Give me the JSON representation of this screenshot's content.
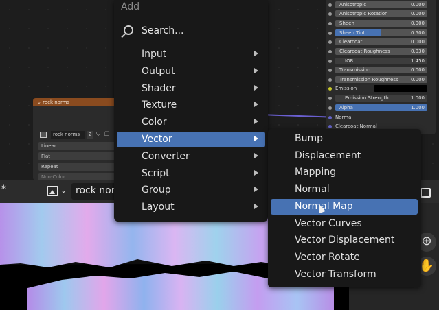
{
  "node_editor": {
    "principled_inputs": [
      {
        "label": "Anisotropic",
        "value": "0.000",
        "kind": "field"
      },
      {
        "label": "Anisotropic Rotation",
        "value": "0.000",
        "kind": "field"
      },
      {
        "label": "Sheen",
        "value": "0.000",
        "kind": "field"
      },
      {
        "label": "Sheen Tint",
        "value": "0.500",
        "kind": "blue-fill"
      },
      {
        "label": "Clearcoat",
        "value": "0.000",
        "kind": "field"
      },
      {
        "label": "Clearcoat Roughness",
        "value": "0.030",
        "kind": "field"
      },
      {
        "label": "IOR",
        "value": "1.450",
        "kind": "dark"
      },
      {
        "label": "Transmission",
        "value": "0.000",
        "kind": "field"
      },
      {
        "label": "Transmission Roughness",
        "value": "0.000",
        "kind": "field"
      },
      {
        "label": "Emission",
        "value": "",
        "kind": "swatch"
      },
      {
        "label": "Emission Strength",
        "value": "1.000",
        "kind": "dark"
      },
      {
        "label": "Alpha",
        "value": "1.000",
        "kind": "full-blue"
      },
      {
        "label": "Normal",
        "value": "",
        "kind": "plain"
      },
      {
        "label": "Clearcoat Normal",
        "value": "",
        "kind": "plain"
      }
    ],
    "texture_node": {
      "title": "rock norms",
      "image_name": "rock norms",
      "user_count": "2",
      "interpolation": "Linear",
      "projection": "Flat",
      "extension": "Repeat",
      "color_space": "Non-Color"
    }
  },
  "image_editor": {
    "image_name": "rock norm",
    "modified_marker": "*"
  },
  "add_menu": {
    "title": "Add",
    "search_label": "Search...",
    "items": [
      "Input",
      "Output",
      "Shader",
      "Texture",
      "Color",
      "Vector",
      "Converter",
      "Script",
      "Group",
      "Layout"
    ],
    "active_item": "Vector"
  },
  "vector_submenu": {
    "items": [
      "Bump",
      "Displacement",
      "Mapping",
      "Normal",
      "Normal Map",
      "Vector Curves",
      "Vector Displacement",
      "Vector Rotate",
      "Vector Transform"
    ],
    "active_item": "Normal Map"
  },
  "colors": {
    "accent": "#4772b3",
    "menu_bg": "#181818",
    "texture_header": "#8a4b1f"
  }
}
